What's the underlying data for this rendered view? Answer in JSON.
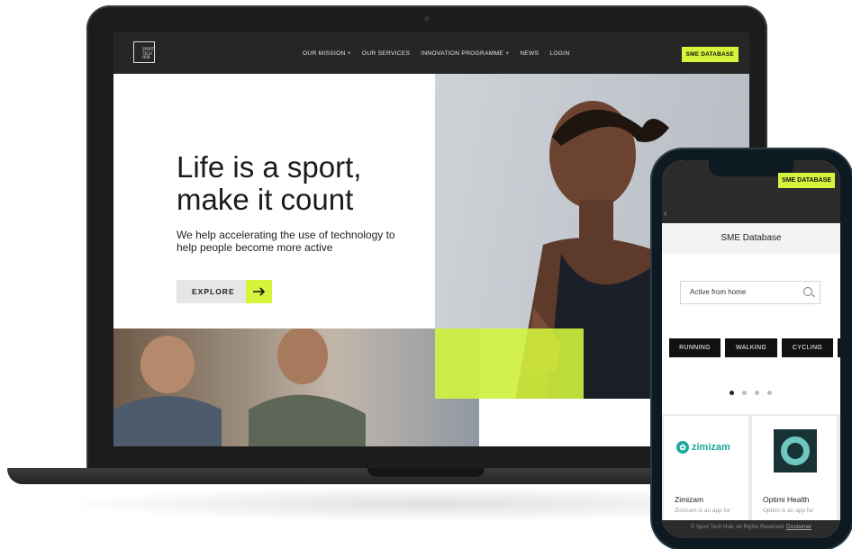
{
  "site": {
    "logo_text": "SPORT TECH HUB",
    "nav": [
      "OUR MISSION  +",
      "OUR SERVICES",
      "INNOVATION PROGRAMME +",
      "NEWS",
      "LOGIN"
    ],
    "cta": "SME DATABASE"
  },
  "hero": {
    "title": "Life is a sport,\nmake it count",
    "subtitle": "We help accelerating the use of technology to help people become more active",
    "button": "EXPLORE",
    "arrow_icon": "arrow-right-icon"
  },
  "phone": {
    "cta": "SME DATABASE",
    "header": "SME Database",
    "search_placeholder": "Active from home",
    "chips": [
      "RUNNING",
      "WALKING",
      "CYCLING"
    ],
    "cards": [
      {
        "logo": "zimizam",
        "name": "Zimizam",
        "desc": "Zimizam is an app for"
      },
      {
        "logo": "optimi-icon",
        "name": "Optimi Health",
        "desc": "Optimi is an app for"
      }
    ],
    "footer_text": "© Sport Tech Hub. All Rights Reserved.",
    "footer_link": "Disclaimer"
  },
  "colors": {
    "accent": "#d4f53c",
    "dark": "#262627"
  }
}
